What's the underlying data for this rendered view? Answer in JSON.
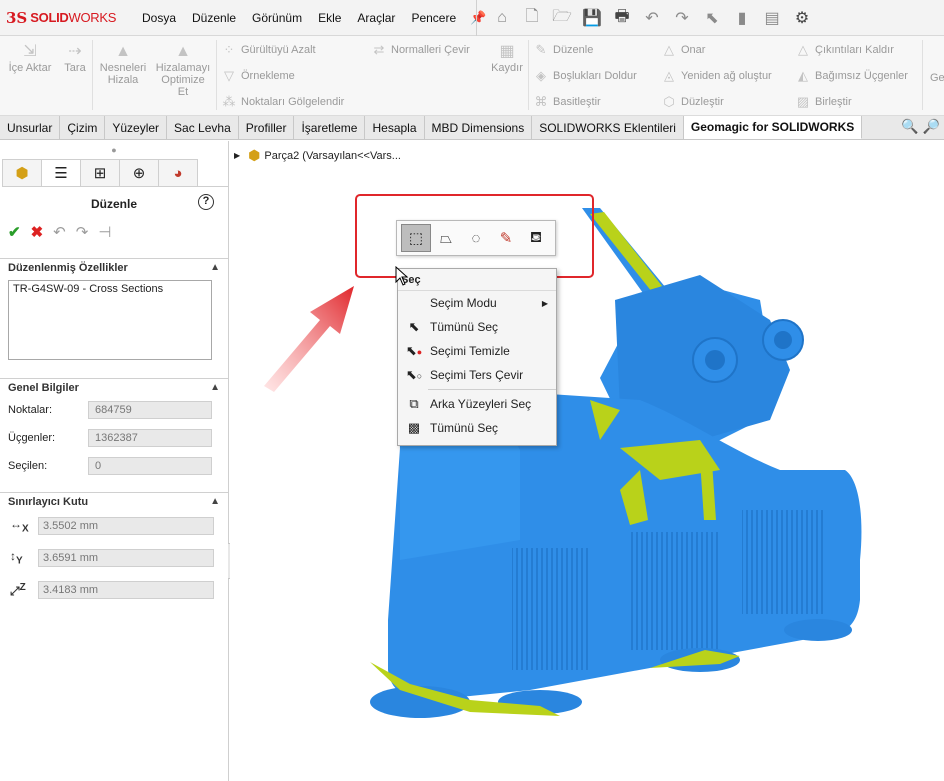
{
  "app": {
    "logo_ds": "3S",
    "logo_solid": "SOLID",
    "logo_works": "WORKS"
  },
  "menu": [
    "Dosya",
    "Düzenle",
    "Görünüm",
    "Ekle",
    "Araçlar",
    "Pencere"
  ],
  "ribbon": {
    "ice_aktar": "İçe Aktar",
    "tara": "Tara",
    "nesneleri_hizala": [
      "Nesneleri",
      "Hizala"
    ],
    "hizalamayi": [
      "Hizalamayı",
      "Optimize",
      "Et"
    ],
    "gurultuyu_azalt": "Gürültüyü Azalt",
    "ornekleme": "Örnekleme",
    "noktalari_golgelendir": "Noktaları Gölgelendir",
    "normalleri_cevir": "Normalleri Çevir",
    "kaydir": "Kaydır",
    "duzenle": "Düzenle",
    "bosluklari_doldur": "Boşlukları Doldur",
    "basitlestir": "Basitleştir",
    "onar": "Onar",
    "yeniden_ag": "Yeniden ağ oluştur",
    "duzlestir": "Düzleştir",
    "cikintilari_kaldir": "Çıkıntıları Kaldır",
    "bagimsiz_ucgenler": "Bağımsız Üçgenler",
    "birlestir": "Birleştir",
    "cut_label": "Ge"
  },
  "tabs": [
    "Unsurlar",
    "Çizim",
    "Yüzeyler",
    "Sac Levha",
    "Profiller",
    "İşaretleme",
    "Hesapla",
    "MBD Dimensions",
    "SOLIDWORKS Eklentileri",
    "Geomagic for SOLIDWORKS"
  ],
  "panel": {
    "title": "Düzenle",
    "help": "?",
    "edited_props_header": "Düzenlenmiş Özellikler",
    "edited_props_value": "TR-G4SW-09 - Cross Sections",
    "general_header": "Genel Bilgiler",
    "points_label": "Noktalar:",
    "points_value": "684759",
    "triangles_label": "Üçgenler:",
    "triangles_value": "1362387",
    "selected_label": "Seçilen:",
    "selected_value": "0",
    "bbox_header": "Sınırlayıcı Kutu",
    "x_axis": "X",
    "y_axis": "Y",
    "z_axis": "Z",
    "x_value": "3.5502 mm",
    "y_value": "3.6591 mm",
    "z_value": "3.4183 mm"
  },
  "tree": {
    "label": "Parça2  (Varsayılan<<Vars..."
  },
  "context_menu": {
    "header": "Seç",
    "items": [
      "Seçim Modu",
      "Tümünü Seç",
      "Seçimi Temizle",
      "Seçimi Ters Çevir",
      "Arka Yüzeyleri Seç",
      "Tümünü Seç"
    ]
  },
  "colors": {
    "accent_red": "#e0262b",
    "model_blue": "#2f8ee8",
    "model_yellow": "#b9d21a",
    "logo_red": "#d71920"
  }
}
